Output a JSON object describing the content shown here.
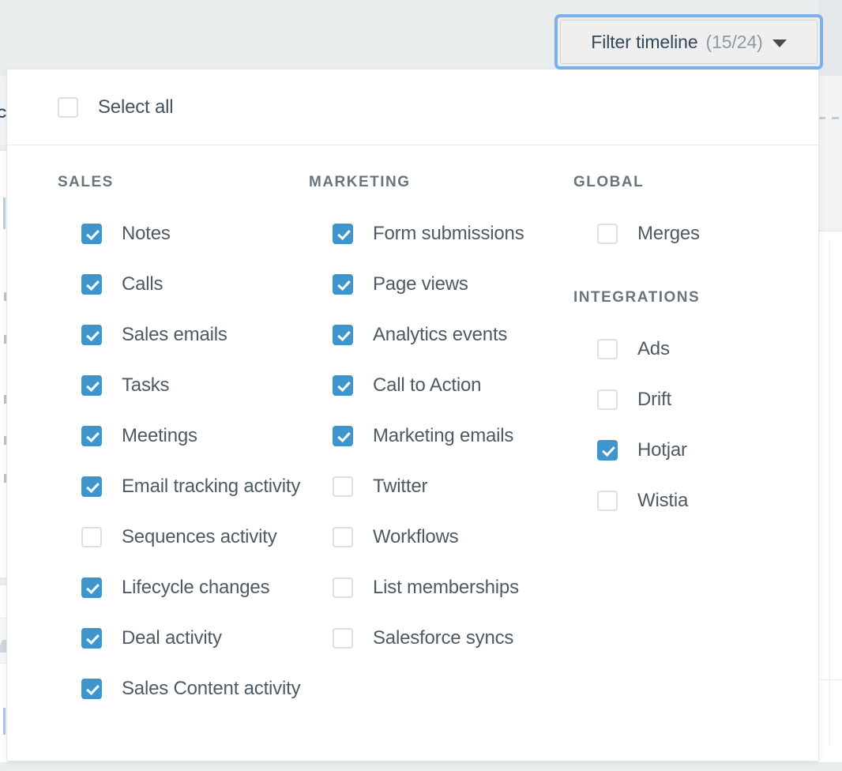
{
  "background": {
    "left_partial_text": "C"
  },
  "filter_button": {
    "label": "Filter timeline",
    "count": "(15/24)",
    "caret": "chevron-down-icon",
    "focused": true,
    "accent_focus_color": "#7eb0e8"
  },
  "dropdown": {
    "select_all": {
      "label": "Select all",
      "checked": false
    },
    "checked_color": "#3f95cd",
    "unchecked_border_color": "#dbdfe2",
    "columns": [
      {
        "key": "sales",
        "groups": [
          {
            "title": "SALES",
            "options": [
              {
                "label": "Notes",
                "checked": true
              },
              {
                "label": "Calls",
                "checked": true
              },
              {
                "label": "Sales emails",
                "checked": true
              },
              {
                "label": "Tasks",
                "checked": true
              },
              {
                "label": "Meetings",
                "checked": true
              },
              {
                "label": "Email tracking activity",
                "checked": true
              },
              {
                "label": "Sequences activity",
                "checked": false
              },
              {
                "label": "Lifecycle changes",
                "checked": true
              },
              {
                "label": "Deal activity",
                "checked": true
              },
              {
                "label": "Sales Content activity",
                "checked": true
              }
            ]
          }
        ]
      },
      {
        "key": "marketing",
        "groups": [
          {
            "title": "MARKETING",
            "options": [
              {
                "label": "Form submissions",
                "checked": true
              },
              {
                "label": "Page views",
                "checked": true
              },
              {
                "label": "Analytics events",
                "checked": true
              },
              {
                "label": "Call to Action",
                "checked": true
              },
              {
                "label": "Marketing emails",
                "checked": true
              },
              {
                "label": "Twitter",
                "checked": false
              },
              {
                "label": "Workflows",
                "checked": false
              },
              {
                "label": "List memberships",
                "checked": false
              },
              {
                "label": "Salesforce syncs",
                "checked": false
              }
            ]
          }
        ]
      },
      {
        "key": "global_integrations",
        "groups": [
          {
            "title": "GLOBAL",
            "options": [
              {
                "label": "Merges",
                "checked": false
              }
            ]
          },
          {
            "title": "INTEGRATIONS",
            "options": [
              {
                "label": "Ads",
                "checked": false
              },
              {
                "label": "Drift",
                "checked": false
              },
              {
                "label": "Hotjar",
                "checked": true
              },
              {
                "label": "Wistia",
                "checked": false
              }
            ]
          }
        ]
      }
    ]
  }
}
